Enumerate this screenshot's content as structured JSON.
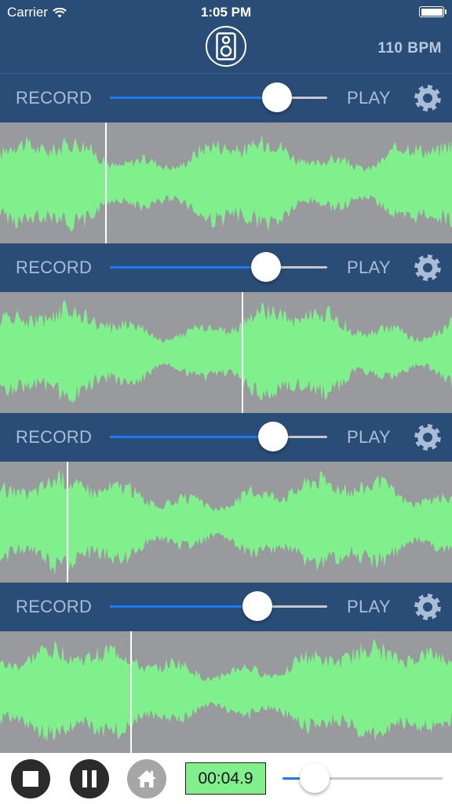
{
  "status_bar": {
    "carrier": "Carrier",
    "time": "1:05 PM"
  },
  "header": {
    "bpm": "110 BPM",
    "speaker_icon": "speaker-icon"
  },
  "colors": {
    "bar": "#2a4d78",
    "waveform": "#80f08c",
    "wave_bg": "#999a9d",
    "slider": "#1a7cf5"
  },
  "tracks": [
    {
      "record_label": "RECORD",
      "play_label": "PLAY",
      "mix": 0.77,
      "playhead": 0.232
    },
    {
      "record_label": "RECORD",
      "play_label": "PLAY",
      "mix": 0.72,
      "playhead": 0.535
    },
    {
      "record_label": "RECORD",
      "play_label": "PLAY",
      "mix": 0.75,
      "playhead": 0.147
    },
    {
      "record_label": "RECORD",
      "play_label": "PLAY",
      "mix": 0.68,
      "playhead": 0.288
    }
  ],
  "footer": {
    "timer": "00:04.9",
    "master_position": 0.2
  }
}
